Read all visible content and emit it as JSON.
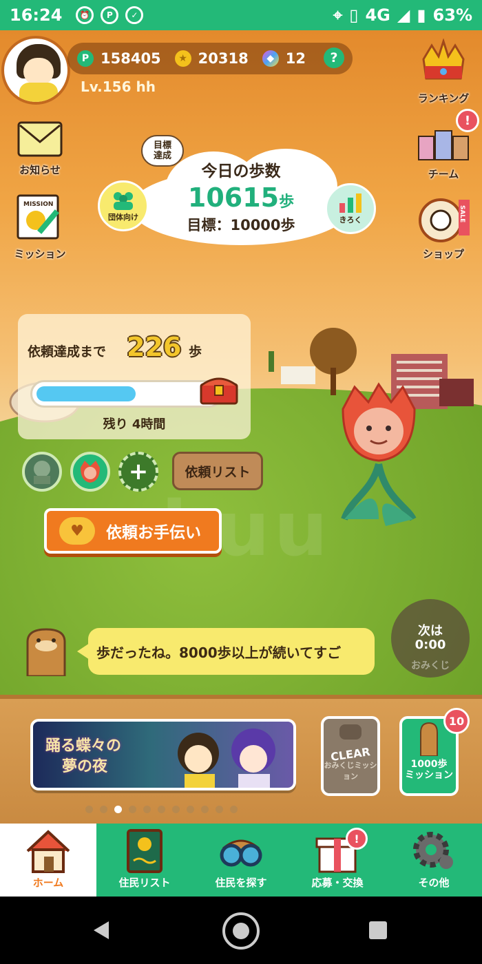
{
  "status_bar": {
    "time": "16:24",
    "network": "4G",
    "battery": "63%"
  },
  "user": {
    "points": "158405",
    "coins": "20318",
    "gems": "12",
    "level": "Lv.156 hh",
    "help": "?"
  },
  "side": {
    "notice": "お知らせ",
    "mission": "ミッション",
    "mission_card_text": "MISSION",
    "ranking": "ランキング",
    "team": "チーム",
    "team_badge": "!",
    "shop": "ショップ",
    "sale_tag": "SALE"
  },
  "steps": {
    "goal_achieved_bubble": [
      "目標",
      "達成"
    ],
    "title": "今日の歩数",
    "value": "10615",
    "unit": "歩",
    "goal": "目標：10000歩",
    "group_button": "団体向け",
    "record_button": "きろく"
  },
  "request": {
    "label": "依頼達成まで",
    "remaining_steps": "226",
    "unit": "歩",
    "progress": 0.55,
    "time_left": "残り 4時間",
    "list_button": "依頼リスト",
    "help_button": "依頼お手伝い",
    "add": "+"
  },
  "watermark": "ukuu",
  "speech": "歩だったね。8000歩以上が続いてすご",
  "omikuji": {
    "line1": "次は",
    "line2": "0:00",
    "label": "おみくじ"
  },
  "banner": {
    "title_line1": "踊る蝶々の",
    "title_line2": "夢の夜"
  },
  "page_dots": {
    "count": 11,
    "active": 2
  },
  "mission_cards": {
    "clear_label": "CLEAR",
    "clear_sub": "おみくじミッション",
    "thousand_line1": "1000歩",
    "thousand_line2": "ミッション",
    "thousand_badge": "10"
  },
  "bottom_nav": [
    {
      "label": "ホーム",
      "icon": "home-icon",
      "active": true
    },
    {
      "label": "住民リスト",
      "icon": "book-icon"
    },
    {
      "label": "住民を探す",
      "icon": "binoculars-icon"
    },
    {
      "label": "応募・交換",
      "icon": "gift-icon",
      "badge": "!"
    },
    {
      "label": "その他",
      "icon": "gear-icon"
    }
  ],
  "colors": {
    "accent_green": "#23b978",
    "orange": "#f07a1f",
    "progress_blue": "#55c8f2",
    "badge_red": "#e9525f"
  }
}
